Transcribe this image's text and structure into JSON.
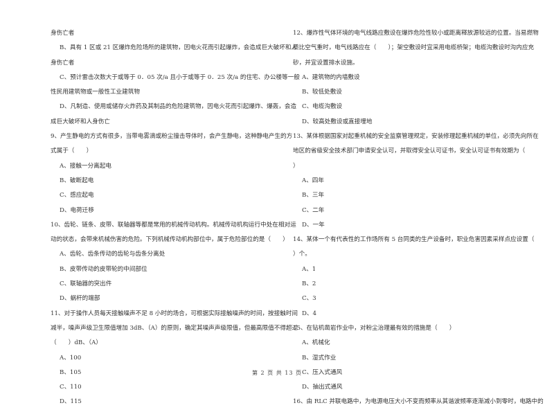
{
  "left_column": [
    {
      "type": "cont",
      "text": "身伤亡者"
    },
    {
      "type": "opt",
      "text": "B、具有 1 区或 21 区爆炸危险场所的建筑物，因电火花而引起爆炸，会造成巨大破坏和人"
    },
    {
      "type": "cont",
      "text": "身伤亡者"
    },
    {
      "type": "opt",
      "text": "C、预计雷击次数大于或等于 0．05 次/a 且小于或等于 0．25 次/a 的住宅、办公楼等一般"
    },
    {
      "type": "cont",
      "text": "性民用建筑物或一般性工业建筑物"
    },
    {
      "type": "opt",
      "text": "D、凡制造、使用或储存火炸药及其制品的危险建筑物，因电火花而引起爆炸、爆轰，会造"
    },
    {
      "type": "cont",
      "text": "成巨大破坏和人身伤亡"
    },
    {
      "type": "q",
      "text": "9、产生静电的方式有很多，当带电雾滴或粉尘撞击导体时，会产生静电，这种静电产生的方"
    },
    {
      "type": "cont",
      "text": "式属于（　　）"
    },
    {
      "type": "opt",
      "text": "A、接触一分离起电"
    },
    {
      "type": "opt",
      "text": "B、破断起电"
    },
    {
      "type": "opt",
      "text": "C、感应起电"
    },
    {
      "type": "opt",
      "text": "D、电荷迁移"
    },
    {
      "type": "q",
      "text": "10、齿轮、链条、皮带、联轴器等都是常用的机械传动机构。机械传动机构运行中处在相对运"
    },
    {
      "type": "cont",
      "text": "动的状态，会带来机械伤害的危险。下列机械传动机构部位中，属于危险部位的是（　　）"
    },
    {
      "type": "opt",
      "text": "A、齿轮、齿条传动的齿轮与齿条分离处"
    },
    {
      "type": "opt",
      "text": "B、皮带传动的皮带轮的中间部位"
    },
    {
      "type": "opt",
      "text": "C、联轴器的突出件"
    },
    {
      "type": "opt",
      "text": "D、蜗杆的端部"
    },
    {
      "type": "q",
      "text": "11、对于操作人员每天接触噪声不足 8 小时的场合，可根据实际接触噪声的时间，按接触时间"
    },
    {
      "type": "cont",
      "text": "减半，噪声声级卫生限值增加 3dB、（A）的原则，确定其噪声声级限值，但最高限值不得超过"
    },
    {
      "type": "cont",
      "text": "（　　）dB、（A）"
    },
    {
      "type": "opt",
      "text": "A、100"
    },
    {
      "type": "opt",
      "text": "B、105"
    },
    {
      "type": "opt",
      "text": "C、110"
    },
    {
      "type": "opt",
      "text": "D、115"
    }
  ],
  "right_column": [
    {
      "type": "q",
      "text": "12、爆炸性气体环境的电气线路应敷设在爆炸危险性较小或距离释放源较远的位置。当易燃物"
    },
    {
      "type": "cont",
      "text": "质比空气重时，电气线路应在（　　）；架空敷设时宜采用电缆桥架；电缆沟敷设时沟内应充"
    },
    {
      "type": "cont",
      "text": "砂，并宜设置排水设施。"
    },
    {
      "type": "opt",
      "text": "A、建筑物的内墙敷设"
    },
    {
      "type": "opt",
      "text": "B、较低处敷设"
    },
    {
      "type": "opt",
      "text": "C、电缆沟敷设"
    },
    {
      "type": "opt",
      "text": "D、较高处敷设或直接埋地"
    },
    {
      "type": "q",
      "text": "13、某体根据国家对起重机械的安全监察管理规定，安装修理起重机械的单位，必须先向所在"
    },
    {
      "type": "cont",
      "text": "地区的省级安全技术部门申请安全认可，并取得安全认可证书，安全认可证书有效期为（"
    },
    {
      "type": "cont",
      "text": "）"
    },
    {
      "type": "opt",
      "text": "A、四年"
    },
    {
      "type": "opt",
      "text": "B、三年"
    },
    {
      "type": "opt",
      "text": "C、二年"
    },
    {
      "type": "opt",
      "text": "D、一年"
    },
    {
      "type": "q",
      "text": "14、某体一个有代表性的工作场所有 5 台同类的生产设备时，职业危害因素采样点应设置（"
    },
    {
      "type": "cont",
      "text": "）个。"
    },
    {
      "type": "opt",
      "text": "A、1"
    },
    {
      "type": "opt",
      "text": "B、2"
    },
    {
      "type": "opt",
      "text": "C、3"
    },
    {
      "type": "opt",
      "text": "D、4"
    },
    {
      "type": "q",
      "text": "15、在钻机凿岩作业中，对粉尘治理最有效的措施是（　　）"
    },
    {
      "type": "opt",
      "text": "A、机械化"
    },
    {
      "type": "opt",
      "text": "B、湿式作业"
    },
    {
      "type": "opt",
      "text": "C、压入式通风"
    },
    {
      "type": "opt",
      "text": "D、抽出式通风"
    },
    {
      "type": "q",
      "text": "16、由 RLC 并联电路中，为电源电压大小不变而频率从其谐波频率逐渐减小到零时，电路中的"
    }
  ],
  "footer": {
    "page_label": "第 2 页 共 13 页"
  }
}
